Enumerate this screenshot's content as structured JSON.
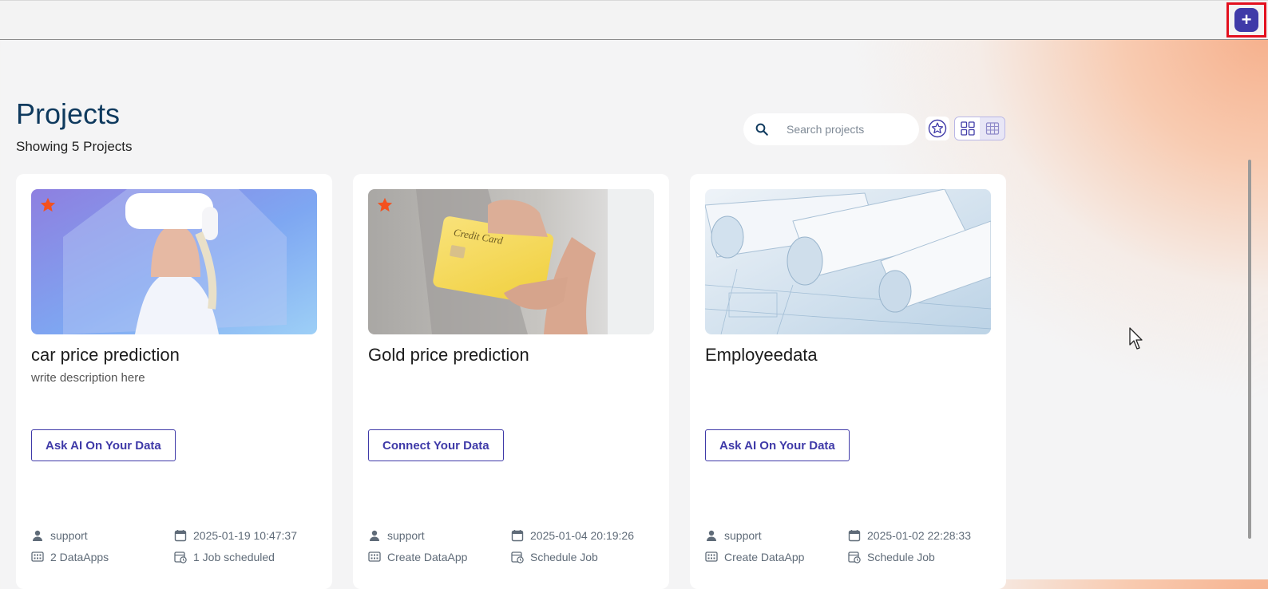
{
  "header": {
    "add_label": "+"
  },
  "page": {
    "title": "Projects",
    "subtitle": "Showing 5 Projects"
  },
  "search": {
    "placeholder": "Search projects",
    "value": ""
  },
  "projects": [
    {
      "name": "car price prediction",
      "description": "write description here",
      "action_label": "Ask AI On Your Data",
      "favorite": true,
      "image": "vr-headset-woman",
      "owner": "support",
      "date": "2025-01-19 10:47:37",
      "dataapps": "2 DataApps",
      "jobs": "1 Job scheduled"
    },
    {
      "name": "Gold price prediction",
      "description": "",
      "action_label": "Connect Your Data",
      "favorite": true,
      "image": "hand-holding-credit-card",
      "card_text": "Credit Card",
      "owner": "support",
      "date": "2025-01-04 20:19:26",
      "dataapps": "Create DataApp",
      "jobs": "Schedule Job"
    },
    {
      "name": "Employeedata",
      "description": "",
      "action_label": "Ask AI On Your Data",
      "favorite": false,
      "image": "blueprint-rolls",
      "owner": "support",
      "date": "2025-01-02 22:28:33",
      "dataapps": "Create DataApp",
      "jobs": "Schedule Job"
    }
  ],
  "colors": {
    "accent": "#3f3aa8",
    "star": "#f4511e",
    "title": "#0f3a5e",
    "highlight": "#e3101e"
  }
}
